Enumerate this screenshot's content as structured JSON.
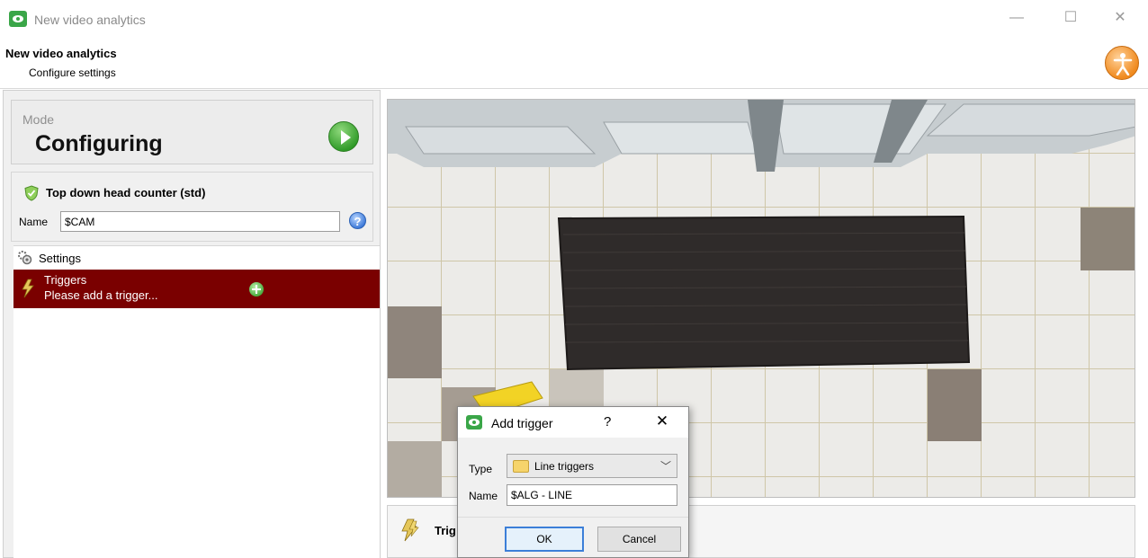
{
  "window": {
    "title": "New video analytics",
    "minimize": "—",
    "maximize": "☐",
    "close": "✕"
  },
  "header": {
    "title": "New video analytics",
    "subtitle": "Configure settings"
  },
  "mode": {
    "label": "Mode",
    "value": "Configuring"
  },
  "algorithm": {
    "title": "Top down head counter (std)",
    "name_label": "Name",
    "name_value": "$CAM"
  },
  "tree": {
    "settings_label": "Settings",
    "triggers_label": "Triggers",
    "triggers_hint": "Please add a trigger..."
  },
  "bottom_panel": {
    "label": "Trig"
  },
  "dialog": {
    "title": "Add trigger",
    "help": "?",
    "close": "✕",
    "type_label": "Type",
    "type_value": "Line triggers",
    "name_label": "Name",
    "name_value": "$ALG - LINE",
    "ok_label": "OK",
    "cancel_label": "Cancel"
  },
  "colors": {
    "selected_row": "#7a0000",
    "accent_green": "#3aa648",
    "ok_border": "#3c7fd8"
  },
  "icons": [
    "app-icon",
    "person-icon",
    "play-icon",
    "shield-check-icon",
    "help-icon",
    "gear-icon",
    "lightning-icon",
    "add-icon",
    "folder-icon",
    "chevron-down-icon",
    "close-icon"
  ]
}
